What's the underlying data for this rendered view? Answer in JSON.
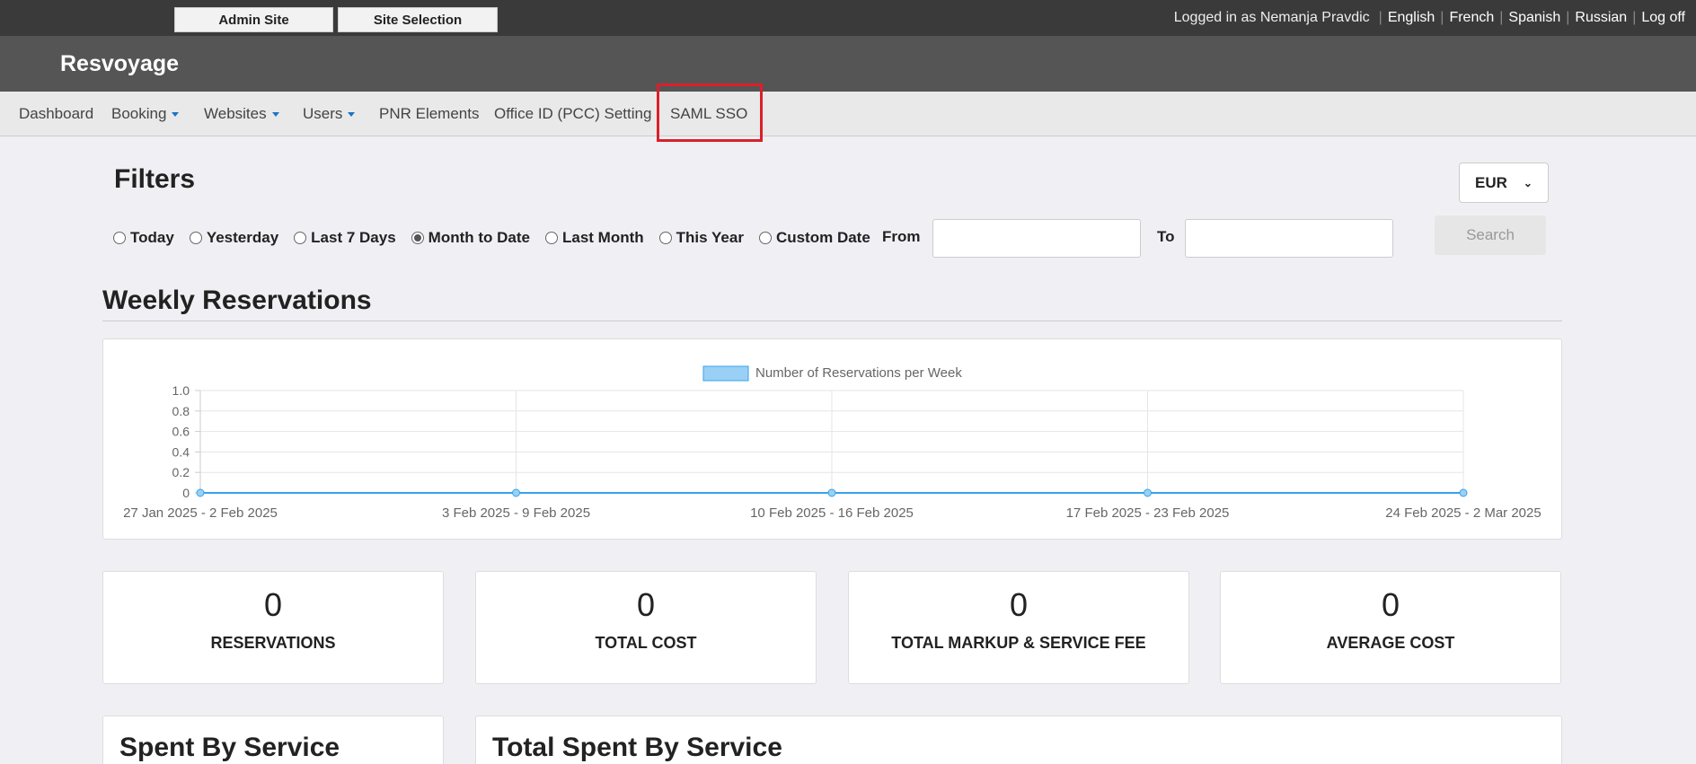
{
  "topbar": {
    "admin_site": "Admin Site",
    "site_selection": "Site Selection",
    "logged_in": "Logged in as Nemanja Pravdic",
    "languages": [
      "English",
      "French",
      "Spanish",
      "Russian"
    ],
    "logoff": "Log off"
  },
  "brand": "Resvoyage",
  "nav": {
    "dashboard": "Dashboard",
    "booking": "Booking",
    "websites": "Websites",
    "users": "Users",
    "pnr": "PNR Elements",
    "office": "Office ID (PCC) Setting",
    "saml": "SAML SSO"
  },
  "filters": {
    "title": "Filters",
    "currency": "EUR",
    "options": [
      "Today",
      "Yesterday",
      "Last 7 Days",
      "Month to Date",
      "Last Month",
      "This Year",
      "Custom Date"
    ],
    "selected": "Month to Date",
    "from_label": "From",
    "to_label": "To",
    "from_value": "",
    "to_value": "",
    "search": "Search"
  },
  "weekly": {
    "title": "Weekly Reservations"
  },
  "chart_data": {
    "type": "line",
    "legend": "Number of Reservations per Week",
    "legend_position": "top-center",
    "categories": [
      "27 Jan 2025 - 2 Feb 2025",
      "3 Feb 2025 - 9 Feb 2025",
      "10 Feb 2025 - 16 Feb 2025",
      "17 Feb 2025 - 23 Feb 2025",
      "24 Feb 2025 - 2 Mar 2025"
    ],
    "series": [
      {
        "name": "Number of Reservations per Week",
        "values": [
          0,
          0,
          0,
          0,
          0
        ]
      }
    ],
    "yticks": [
      "1.0",
      "0.8",
      "0.6",
      "0.4",
      "0.2",
      "0"
    ],
    "ylim": [
      0,
      1
    ],
    "grid": true,
    "color": "#36a2eb",
    "fill": "#9ad0f5"
  },
  "stats": [
    {
      "value": "0",
      "label": "RESERVATIONS"
    },
    {
      "value": "0",
      "label": "TOTAL COST"
    },
    {
      "value": "0",
      "label": "TOTAL MARKUP & SERVICE FEE"
    },
    {
      "value": "0",
      "label": "AVERAGE COST"
    }
  ],
  "bottom": {
    "spent_by_service": "Spent By Service",
    "total_spent_by_service": "Total Spent By Service"
  }
}
